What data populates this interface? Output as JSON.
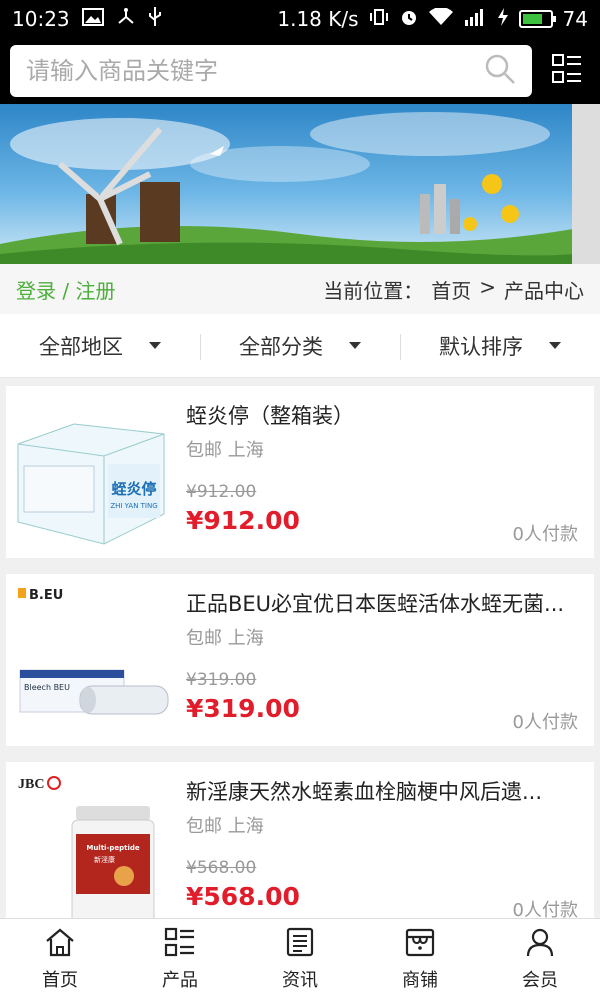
{
  "status_bar": {
    "time": "10:23",
    "net_speed": "1.18 K/s",
    "battery": "74",
    "battery_level": 0.74
  },
  "search": {
    "placeholder": "请输入商品关键字"
  },
  "userbar": {
    "login": "登录 / 注册",
    "location_label": "当前位置：",
    "crumb_home": "首页",
    "crumb_sep": ">",
    "crumb_current": "产品中心"
  },
  "filters": [
    {
      "label": "全部地区"
    },
    {
      "label": "全部分类"
    },
    {
      "label": "默认排序"
    }
  ],
  "products": [
    {
      "title": "蛭炎停（整箱装）",
      "ship": "包邮 上海",
      "old_price": "¥912.00",
      "price": "¥912.00",
      "paid": "0人付款",
      "brand": "",
      "pkg_text": "蛭炎停",
      "pkg_sub": "ZHI YAN TING"
    },
    {
      "title": "正品BEU必宜优日本医蛭活体水蛭无菌...",
      "ship": "包邮 上海",
      "old_price": "¥319.00",
      "price": "¥319.00",
      "paid": "0人付款",
      "brand": "B.EU",
      "pkg_text": "Bleech BEU",
      "pkg_sub": ""
    },
    {
      "title": "新淫康天然水蛭素血栓脑梗中风后遗...",
      "ship": "包邮 上海",
      "old_price": "¥568.00",
      "price": "¥568.00",
      "paid": "0人付款",
      "brand": "JBC",
      "pkg_text": "Multi-peptide",
      "pkg_sub": "新淫康"
    }
  ],
  "tabs": [
    {
      "label": "首页",
      "icon": "home-icon"
    },
    {
      "label": "产品",
      "icon": "grid-list-icon"
    },
    {
      "label": "资讯",
      "icon": "news-icon"
    },
    {
      "label": "商铺",
      "icon": "shop-icon"
    },
    {
      "label": "会员",
      "icon": "user-icon"
    }
  ],
  "colors": {
    "accent_green": "#4caf3a",
    "price_red": "#e21d2b"
  }
}
